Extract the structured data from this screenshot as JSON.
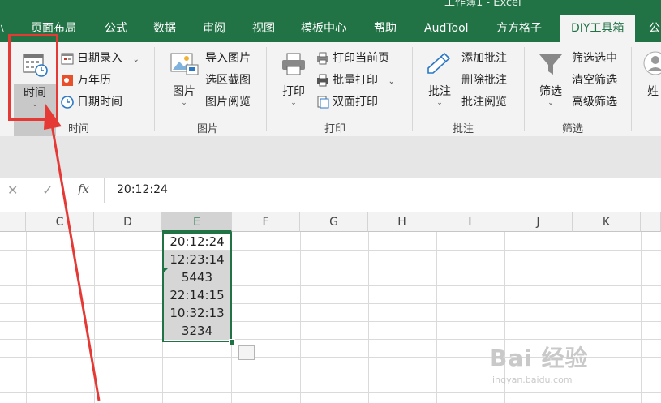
{
  "window": {
    "title": "工作簿1 - Excel"
  },
  "tabs": [
    {
      "label": "页面布局"
    },
    {
      "label": "公式"
    },
    {
      "label": "数据"
    },
    {
      "label": "审阅"
    },
    {
      "label": "视图"
    },
    {
      "label": "模板中心"
    },
    {
      "label": "帮助"
    },
    {
      "label": "AudTool"
    },
    {
      "label": "方方格子"
    },
    {
      "label": "DIY工具箱",
      "active": true
    },
    {
      "label": "公"
    }
  ],
  "ribbon": {
    "time_group": {
      "label": "时间",
      "big_button": "时间",
      "items": [
        {
          "label": "日期录入"
        },
        {
          "label": "万年历"
        },
        {
          "label": "日期时间"
        }
      ]
    },
    "picture_group": {
      "label": "图片",
      "big_button": "图片",
      "items": [
        {
          "label": "导入图片"
        },
        {
          "label": "选区截图"
        },
        {
          "label": "图片阅览"
        }
      ]
    },
    "print_group": {
      "label": "打印",
      "big_button": "打印",
      "items": [
        {
          "label": "打印当前页"
        },
        {
          "label": "批量打印"
        },
        {
          "label": "双面打印"
        }
      ]
    },
    "comment_group": {
      "label": "批注",
      "big_button": "批注",
      "items": [
        {
          "label": "添加批注"
        },
        {
          "label": "删除批注"
        },
        {
          "label": "批注阅览"
        }
      ]
    },
    "filter_group": {
      "label": "筛选",
      "big_button": "筛选",
      "items": [
        {
          "label": "筛选选中"
        },
        {
          "label": "清空筛选"
        },
        {
          "label": "高级筛选"
        }
      ]
    },
    "extra_button": "姓"
  },
  "formula_bar": {
    "fx": "fx",
    "value": "20:12:24"
  },
  "columns": [
    "C",
    "D",
    "E",
    "F",
    "G",
    "H",
    "I",
    "J",
    "K"
  ],
  "selected_column": "E",
  "cells_E": [
    "20:12:24",
    "12:23:14",
    "5443",
    "22:14:15",
    "10:32:13",
    "3234"
  ],
  "watermark": {
    "main": "Bai 经验",
    "sub": "jingyan.baidu.com"
  },
  "colors": {
    "excel_green": "#217346",
    "highlight_red": "#e53935"
  }
}
